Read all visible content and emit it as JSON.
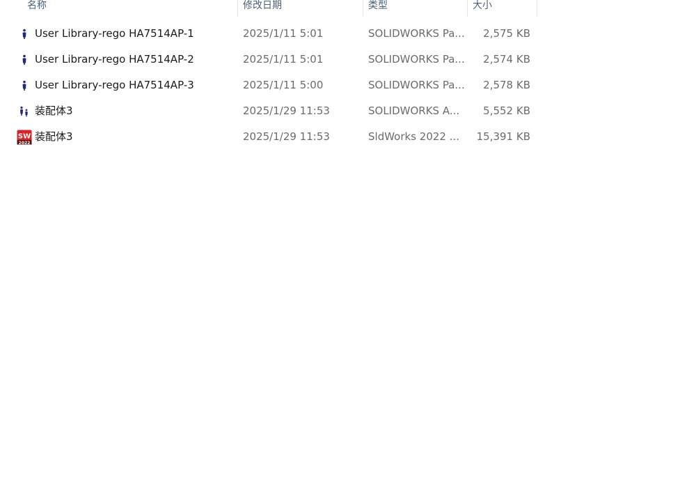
{
  "columns": {
    "name": "名称",
    "date": "修改日期",
    "type": "类型",
    "size": "大小"
  },
  "files": [
    {
      "icon": "solidworks-part-icon",
      "name": "User Library-rego HA7514AP-1",
      "date": "2025/1/11 5:01",
      "type": "SOLIDWORKS Pa...",
      "size": "2,575 KB"
    },
    {
      "icon": "solidworks-part-icon",
      "name": "User Library-rego HA7514AP-2",
      "date": "2025/1/11 5:01",
      "type": "SOLIDWORKS Pa...",
      "size": "2,574 KB"
    },
    {
      "icon": "solidworks-part-icon",
      "name": "User Library-rego HA7514AP-3",
      "date": "2025/1/11 5:00",
      "type": "SOLIDWORKS Pa...",
      "size": "2,578 KB"
    },
    {
      "icon": "solidworks-assembly-icon",
      "name": "装配体3",
      "date": "2025/1/29 11:53",
      "type": "SOLIDWORKS A...",
      "size": "5,552 KB"
    },
    {
      "icon": "sldworks-2022-icon",
      "name": "装配体3",
      "date": "2025/1/29 11:53",
      "type": "SldWorks 2022 ...",
      "size": "15,391 KB"
    }
  ],
  "sw_icon_text": {
    "top": "SW",
    "bottom": "2022"
  },
  "colors": {
    "header_text": "#4c607a",
    "part_icon": "#1f2a7a",
    "sw_logo_red": "#d3232b"
  }
}
